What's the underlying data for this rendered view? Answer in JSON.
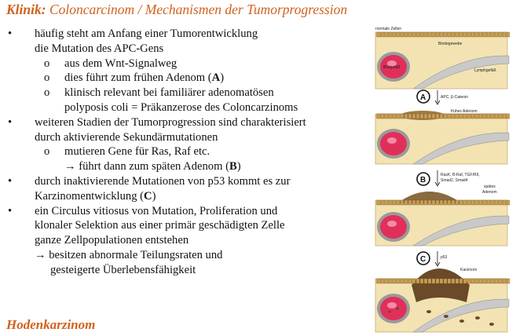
{
  "title": {
    "prefix": "Klinik:",
    "text": "Coloncarcinom / Mechanismen der Tumorprogression"
  },
  "bullets": {
    "b1_l1": "häufig steht am Anfang einer Tumorentwicklung",
    "b1_l2": "die Mutation des APC-Gens",
    "b1_s1": "aus dem Wnt-Signalweg",
    "b1_s2_pre": "dies führt zum frühen Adenom (",
    "b1_s2_key": "A",
    "b1_s2_post": ")",
    "b1_s3_l1": "klinisch relevant bei familiärer adenomatösen",
    "b1_s3_l2": "polyposis coli = Präkanzerose des Coloncarzinoms",
    "b2_l1": "weiteren Stadien der Tumorprogression sind charakterisiert",
    "b2_l2": "durch aktivierende Sekundärmutationen",
    "b2_s1": "mutieren Gene für Ras, Raf etc.",
    "b2_s1_cont_pre": "führt dann zum späten Adenom (",
    "b2_s1_cont_key": "B",
    "b2_s1_cont_post": ")",
    "b3_l1": "durch inaktivierende Mutationen von p53 kommt es zur",
    "b3_l2_pre": "Karzinomentwicklung (",
    "b3_l2_key": "C",
    "b3_l2_post": ")",
    "b4_l1": "ein Circulus vitiosus von Mutation, Proliferation und",
    "b4_l2": "klonaler Selektion aus einer primär geschädigten Zelle",
    "b4_l3": "ganze Zellpopulationen entstehen",
    "b4_l4": "besitzen abnormale Teilungsraten und",
    "b4_l5": "gesteigerte Überlebensfähigkeit",
    "bullet_char": "•",
    "sub_char": "o",
    "arrow_char": "→"
  },
  "next_heading": "Hodenkarzinom",
  "figure": {
    "label_normal": "normale Zellen",
    "label_binde": "Bindegewebe",
    "label_blut": "Blutgefäß",
    "label_lymph": "Lymphgefäß",
    "step_a": "A",
    "step_a_text": "APC, β-Catenin",
    "label_fruehes": "frühes Adenom",
    "step_b": "B",
    "step_b_text1": "RasK, B-Raf, TGF/RII,",
    "step_b_text2": "Smad2, Smad4",
    "label_spaetes1": "spätes",
    "label_spaetes2": "Adenom",
    "step_c": "C",
    "step_c_text": "p53",
    "label_karzinom": "Karzinom",
    "colors": {
      "title": "#d0621c",
      "tissue": "#f3e3b3",
      "tissue_edge": "#b89a52",
      "vessel": "#e0305a",
      "vessel_rim": "#8a8a8a",
      "lymph": "#c9c9c9",
      "tumor": "#7a5a36"
    }
  }
}
